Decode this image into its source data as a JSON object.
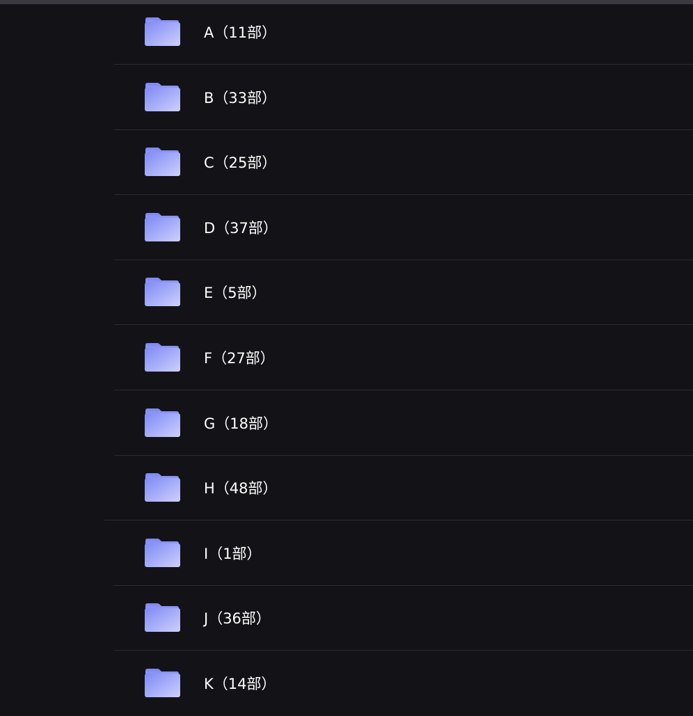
{
  "folders": [
    {
      "label": "A（11部）"
    },
    {
      "label": "B（33部）"
    },
    {
      "label": "C（25部）"
    },
    {
      "label": "D（37部）"
    },
    {
      "label": "E（5部）"
    },
    {
      "label": "F（27部）"
    },
    {
      "label": "G（18部）"
    },
    {
      "label": "H（48部）"
    },
    {
      "label": "I（1部）"
    },
    {
      "label": "J（36部）"
    },
    {
      "label": "K（14部）"
    }
  ],
  "colors": {
    "background": "#131317",
    "divider": "#2a2a30",
    "folder_top": "#8c95f7",
    "folder_bottom": "#c4c8fb",
    "text": "#ffffff"
  },
  "icons": {
    "folder": "folder-icon"
  }
}
